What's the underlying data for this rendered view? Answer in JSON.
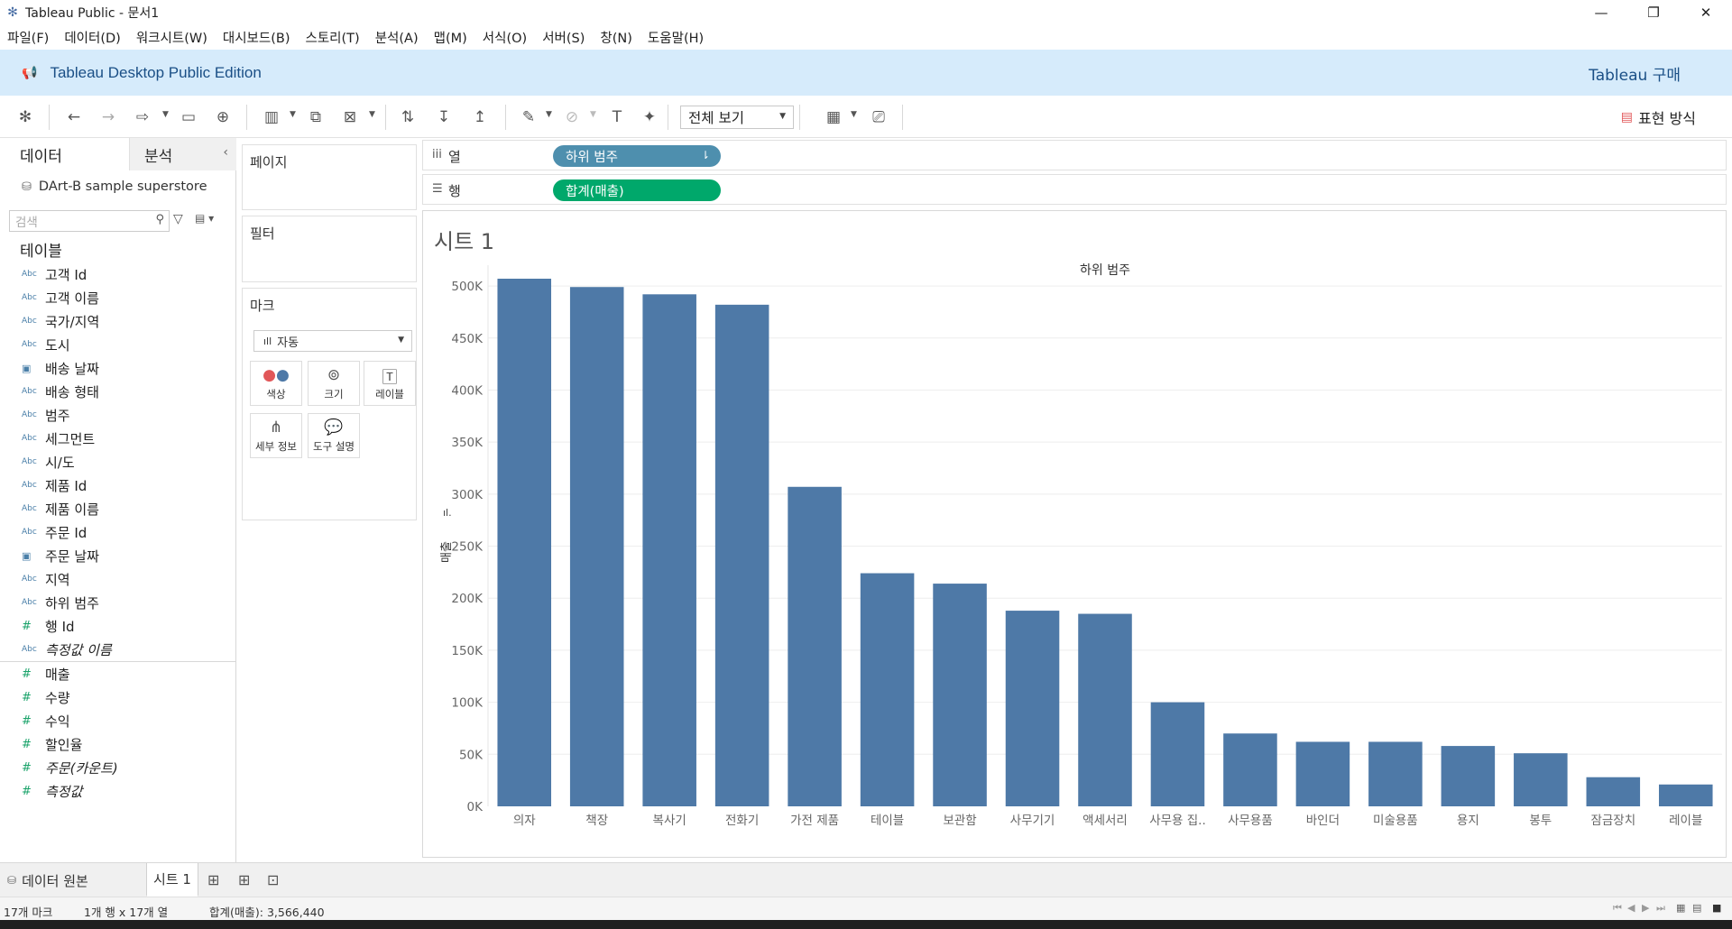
{
  "titlebar": {
    "title": "Tableau Public - 문서1"
  },
  "menu": {
    "items": [
      "파일(F)",
      "데이터(D)",
      "워크시트(W)",
      "대시보드(B)",
      "스토리(T)",
      "분석(A)",
      "맵(M)",
      "서식(O)",
      "서버(S)",
      "창(N)",
      "도움말(H)"
    ]
  },
  "banner": {
    "title": "Tableau Desktop Public Edition",
    "buy": "Tableau 구매"
  },
  "toolbar": {
    "view_select": "전체 보기",
    "show_me": "표현 방식"
  },
  "left_pane": {
    "tabs": [
      "데이터",
      "분석"
    ],
    "datasource": "DArt-B sample superstore",
    "search_placeholder": "검색",
    "table_header": "테이블",
    "dimensions": [
      {
        "type": "Abc",
        "name": "고객 Id"
      },
      {
        "type": "Abc",
        "name": "고객 이름"
      },
      {
        "type": "Abc",
        "name": "국가/지역"
      },
      {
        "type": "Abc",
        "name": "도시"
      },
      {
        "type": "date",
        "name": "배송 날짜"
      },
      {
        "type": "Abc",
        "name": "배송 형태"
      },
      {
        "type": "Abc",
        "name": "범주"
      },
      {
        "type": "Abc",
        "name": "세그먼트"
      },
      {
        "type": "Abc",
        "name": "시/도"
      },
      {
        "type": "Abc",
        "name": "제품 Id"
      },
      {
        "type": "Abc",
        "name": "제품 이름"
      },
      {
        "type": "Abc",
        "name": "주문 Id"
      },
      {
        "type": "date",
        "name": "주문 날짜"
      },
      {
        "type": "Abc",
        "name": "지역"
      },
      {
        "type": "Abc",
        "name": "하위 범주"
      },
      {
        "type": "#",
        "name": "행 Id"
      },
      {
        "type": "Abc",
        "name": "측정값 이름",
        "italic": true
      }
    ],
    "measures": [
      {
        "type": "#",
        "name": "매출"
      },
      {
        "type": "#",
        "name": "수량"
      },
      {
        "type": "#",
        "name": "수익"
      },
      {
        "type": "#",
        "name": "할인율"
      },
      {
        "type": "#",
        "name": "주문(카운트)",
        "italic": true
      },
      {
        "type": "#",
        "name": "측정값",
        "italic": true
      }
    ]
  },
  "cards": {
    "pages": "페이지",
    "filters": "필터",
    "marks": "마크",
    "mark_type": "자동",
    "mark_buttons": [
      "색상",
      "크기",
      "레이블",
      "세부 정보",
      "도구 설명"
    ]
  },
  "shelves": {
    "columns": {
      "label": "열",
      "pill": "하위 범주"
    },
    "rows": {
      "label": "행",
      "pill": "합계(매출)"
    }
  },
  "sheet": {
    "title": "시트 1"
  },
  "chart_data": {
    "type": "bar",
    "title": "하위 범주",
    "ylabel": "매출",
    "ylim": [
      0,
      520000
    ],
    "yticks": [
      "0K",
      "50K",
      "100K",
      "150K",
      "200K",
      "250K",
      "300K",
      "350K",
      "400K",
      "450K",
      "500K"
    ],
    "categories": [
      "의자",
      "책장",
      "복사기",
      "전화기",
      "가전 제품",
      "테이블",
      "보관함",
      "사무기기",
      "액세서리",
      "사무용 집..",
      "사무용품",
      "바인더",
      "미술용품",
      "용지",
      "봉투",
      "잠금장치",
      "레이블"
    ],
    "values": [
      507000,
      499000,
      492000,
      482000,
      307000,
      224000,
      214000,
      188000,
      185000,
      100000,
      70000,
      62000,
      62000,
      58000,
      51000,
      28000,
      21000
    ],
    "bar_color": "#4e79a7",
    "grid": true
  },
  "bottom_tabs": {
    "datasource": "데이터 원본",
    "sheet": "시트 1"
  },
  "status": {
    "marks": "17개 마크",
    "rows_cols": "1개 행  x  17개 열",
    "sum": "합계(매출): 3,566,440"
  }
}
